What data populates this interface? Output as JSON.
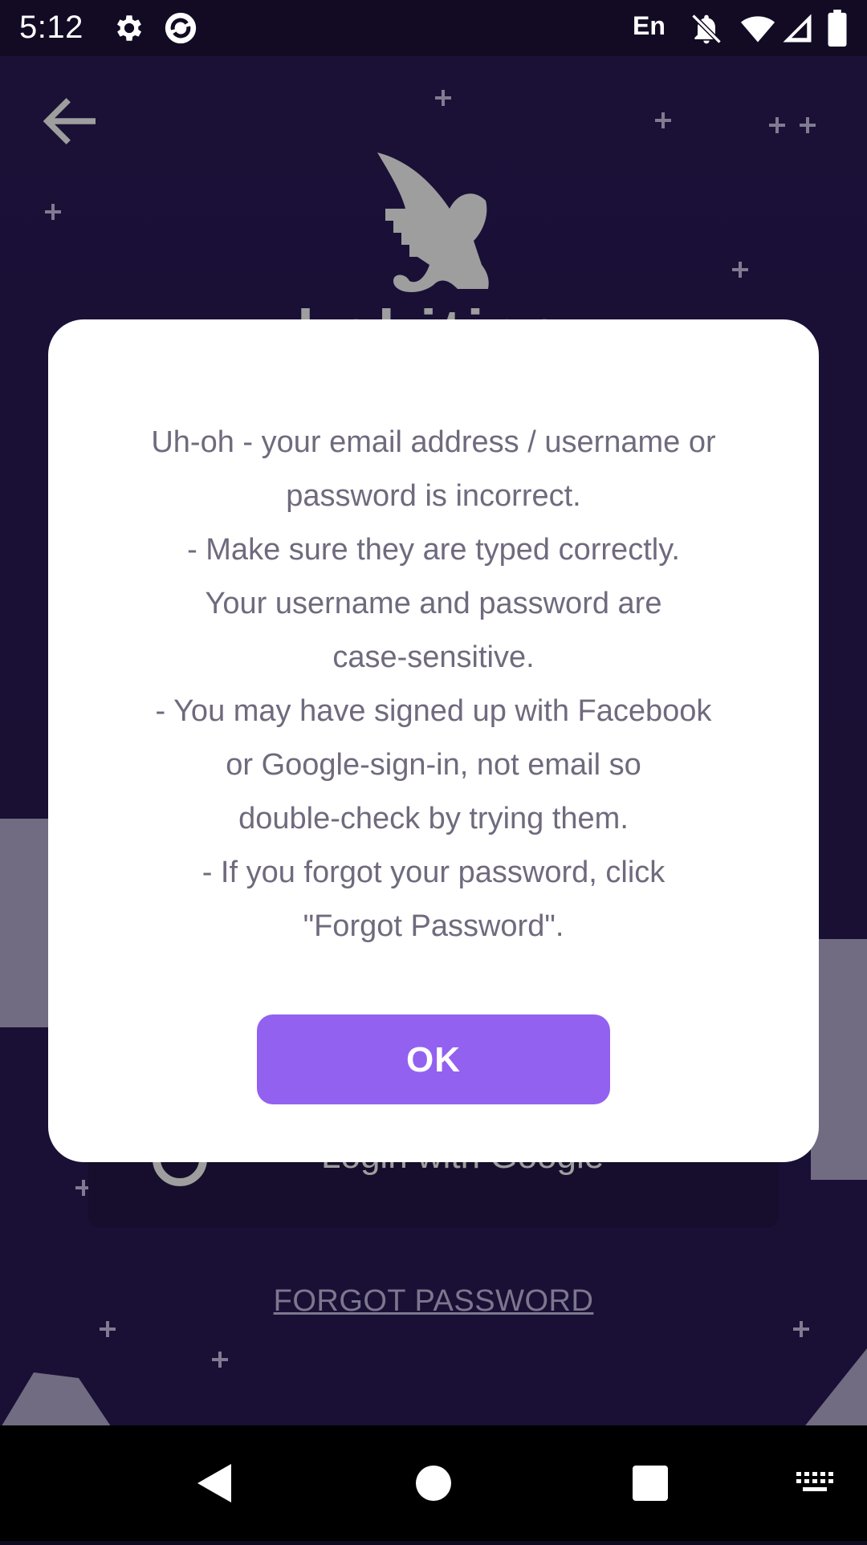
{
  "status_bar": {
    "time": "5:12",
    "language": "En",
    "icons": [
      "settings-icon",
      "app-sync-icon",
      "notifications-off-icon",
      "wifi-icon",
      "signal-icon",
      "battery-icon"
    ]
  },
  "login_screen": {
    "back_icon": "arrow-back-icon",
    "logo_text": "habitica",
    "google_login_label": "Login with Google",
    "forgot_password": "FORGOT PASSWORD"
  },
  "dialog": {
    "message_lines": [
      "Uh-oh - your email address / username or",
      "password is incorrect.",
      "- Make sure they are typed correctly.",
      "Your username and password are",
      "case-sensitive.",
      "- You may have signed up with Facebook",
      "or Google-sign-in, not email so",
      "double-check by trying them.",
      "- If you forgot your password, click",
      "\"Forgot Password\"."
    ],
    "ok_label": "OK",
    "ok_color": "#9361f0"
  },
  "nav_bar": {
    "icons": [
      "nav-back-icon",
      "nav-home-icon",
      "nav-recents-icon",
      "keyboard-icon"
    ]
  }
}
